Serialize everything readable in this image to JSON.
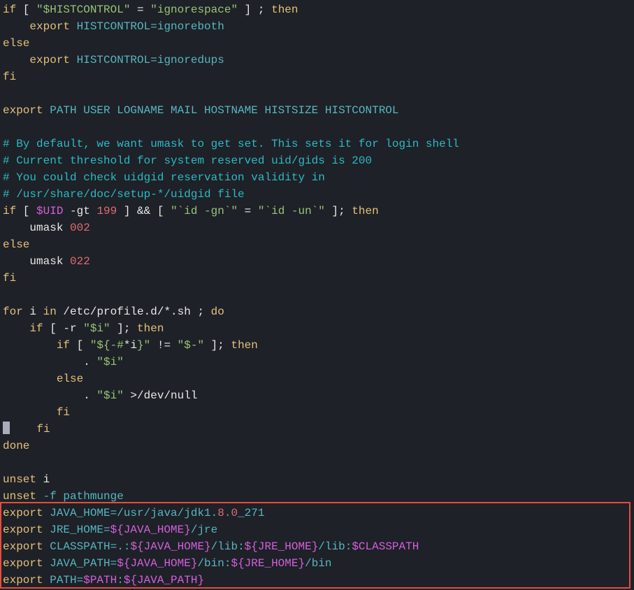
{
  "lines": {
    "l1": {
      "t1": "if",
      "t2": " [ ",
      "t3": "\"$HISTCONTROL\"",
      "t4": " = ",
      "t5": "\"ignorespace\"",
      "t6": " ] ; ",
      "t7": "then"
    },
    "l2": {
      "t1": "    ",
      "t2": "export",
      "t3": " HISTCONTROL=ignoreboth"
    },
    "l3": {
      "t1": "else"
    },
    "l4": {
      "t1": "    ",
      "t2": "export",
      "t3": " HISTCONTROL=ignoredups"
    },
    "l5": {
      "t1": "fi"
    },
    "l6": {
      "blank": " "
    },
    "l7": {
      "t1": "export",
      "t2": " PATH USER LOGNAME MAIL HOSTNAME HISTSIZE HISTCONTROL"
    },
    "l8": {
      "blank": " "
    },
    "l9": {
      "t1": "# By default, we want umask to get set. This sets it for login shell"
    },
    "l10": {
      "t1": "# Current threshold for system reserved uid/gids is 200"
    },
    "l11": {
      "t1": "# You could check uidgid reservation validity in"
    },
    "l12": {
      "t1": "# /usr/share/doc/setup-*/uidgid file"
    },
    "l13": {
      "t1": "if",
      "t2": " [ ",
      "t3": "$UID",
      "t4": " -gt ",
      "t5": "199",
      "t6": " ] && [ ",
      "t7": "\"`id -gn`\"",
      "t8": " = ",
      "t9": "\"`id -un`\"",
      "t10": " ]; ",
      "t11": "then"
    },
    "l14": {
      "t1": "    umask ",
      "t2": "002"
    },
    "l15": {
      "t1": "else"
    },
    "l16": {
      "t1": "    umask ",
      "t2": "022"
    },
    "l17": {
      "t1": "fi"
    },
    "l18": {
      "blank": " "
    },
    "l19": {
      "t1": "for",
      "t2": " i ",
      "t3": "in",
      "t4": " /etc/profile.d/*.sh ; ",
      "t5": "do"
    },
    "l20": {
      "t1": "    ",
      "t2": "if",
      "t3": " [ -r ",
      "t4": "\"$i\"",
      "t5": " ]; ",
      "t6": "then"
    },
    "l21": {
      "t1": "        ",
      "t2": "if",
      "t3": " [ ",
      "t4": "\"${-#",
      "t5": "*i",
      "t6": "}\"",
      "t7": " != ",
      "t8": "\"$-\"",
      "t9": " ]; ",
      "t10": "then"
    },
    "l22": {
      "t1": "            . ",
      "t2": "\"$i\""
    },
    "l23": {
      "t1": "        ",
      "t2": "else"
    },
    "l24": {
      "t1": "            . ",
      "t2": "\"$i\"",
      "t3": " >/dev/null"
    },
    "l25": {
      "t1": "        ",
      "t2": "fi"
    },
    "l26": {
      "t1": "    ",
      "t2": "fi"
    },
    "l27": {
      "t1": "done"
    },
    "l28": {
      "blank": " "
    },
    "l29": {
      "t1": "unset",
      "t2": " i"
    },
    "l30": {
      "t1": "unset",
      "t2": " -f pathmunge"
    },
    "l31": {
      "t1": "export",
      "t2": " JAVA_HOME=/usr/java/jdk1.",
      "t3": "8.0",
      "t4": "_271"
    },
    "l32": {
      "t1": "export",
      "t2": " JRE_HOME=",
      "t3": "${JAVA_HOME}",
      "t4": "/jre"
    },
    "l33": {
      "t1": "export",
      "t2": " CLASSPATH=.:",
      "t3": "${JAVA_HOME}",
      "t4": "/lib:",
      "t5": "${JRE_HOME}",
      "t6": "/lib:",
      "t7": "$CLASSPATH"
    },
    "l34": {
      "t1": "export",
      "t2": " JAVA_PATH=",
      "t3": "${JAVA_HOME}",
      "t4": "/bin:",
      "t5": "${JRE_HOME}",
      "t6": "/bin"
    },
    "l35": {
      "t1": "export",
      "t2": " PATH=",
      "t3": "$PATH",
      "t4": ":",
      "t5": "${JAVA_PATH}"
    }
  }
}
